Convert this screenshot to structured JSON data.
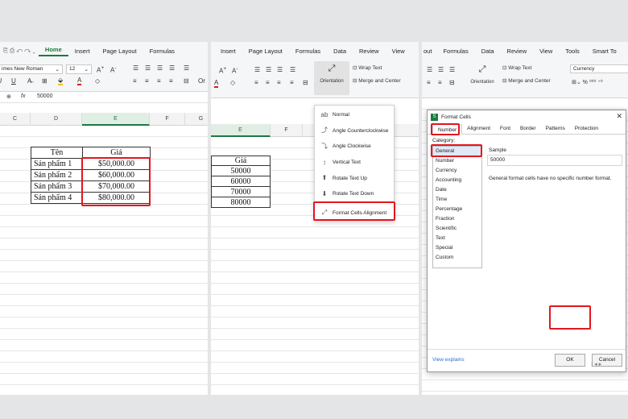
{
  "panel1": {
    "tabs": [
      "Home",
      "Insert",
      "Page Layout",
      "Formulas"
    ],
    "active_tab": "Home",
    "font_name": "imes New Roman",
    "font_size": "12",
    "formula_value": "50000",
    "columns": [
      "C",
      "D",
      "E",
      "F",
      "G"
    ],
    "selected_column": "E",
    "table": {
      "headers": [
        "Tên",
        "Giá"
      ],
      "rows": [
        [
          "Sản phẩm 1",
          "$50,000.00"
        ],
        [
          "Sản phẩm 2",
          "$60,000.00"
        ],
        [
          "Sản phẩm 3",
          "$70,000.00"
        ],
        [
          "Sản phẩm 4",
          "$80,000.00"
        ]
      ]
    }
  },
  "panel2": {
    "tabs": [
      "Insert",
      "Page Layout",
      "Formulas",
      "Data",
      "Review",
      "View"
    ],
    "orientation_label": "Orientation",
    "wrap_text_label": "Wrap Text",
    "merge_center_label": "Merge and Center",
    "columns": [
      "E",
      "F"
    ],
    "selected_column": "E",
    "table": {
      "header": "Giá",
      "values": [
        "50000",
        "60000",
        "70000",
        "80000"
      ]
    },
    "menu_items": [
      "Normal",
      "Angle Counterclockwise",
      "Angle Clockwise",
      "Vertical Text",
      "Rotate Text Up",
      "Rotate Text Down",
      "Format Cells Alignment"
    ]
  },
  "panel3": {
    "tabs": [
      "out",
      "Formulas",
      "Data",
      "Review",
      "View",
      "Tools",
      "Smart To"
    ],
    "orientation_label": "Orientation",
    "wrap_text_label": "Wrap Text",
    "merge_center_label": "Merge and Center",
    "number_format": "Currency",
    "dialog": {
      "title": "Format Cells",
      "tabs": [
        "Number",
        "Alignment",
        "Font",
        "Border",
        "Patterns",
        "Protection"
      ],
      "category_label": "Category:",
      "categories": [
        "General",
        "Number",
        "Currency",
        "Accounting",
        "Date",
        "Time",
        "Percentage",
        "Fraction",
        "Scientific",
        "Text",
        "Special",
        "Custom"
      ],
      "selected_category": "General",
      "sample_label": "Sample",
      "sample_value": "50000",
      "description": "General format cells have no specific number format.",
      "view_explains": "View explains",
      "ok_label": "OK",
      "cancel_label": "Cancel"
    }
  },
  "colors": {
    "accent_green": "#1b7a3f",
    "highlight_red": "#e3161e"
  }
}
